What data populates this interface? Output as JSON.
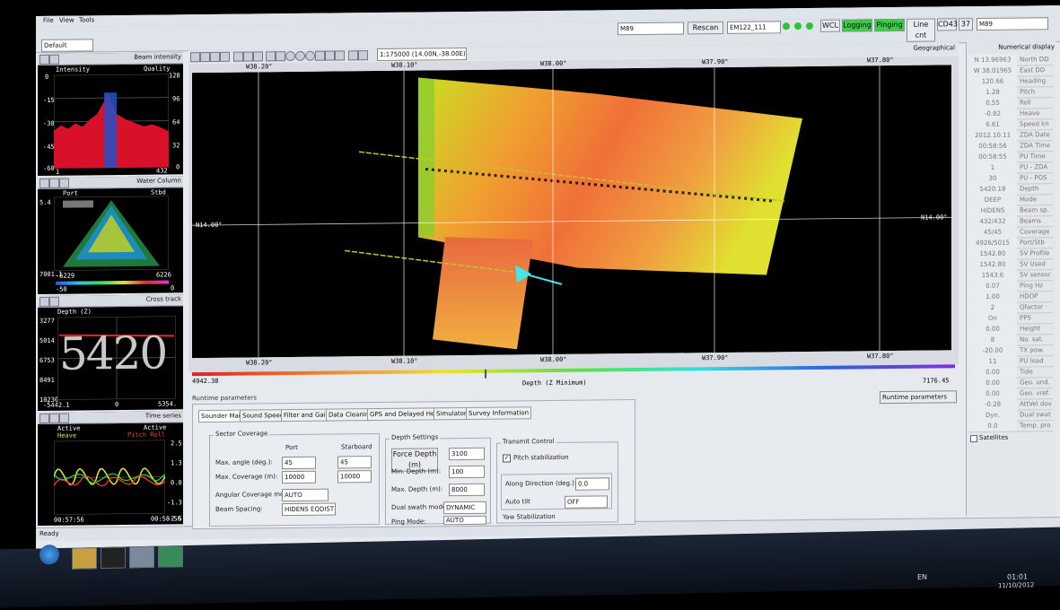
{
  "window": {
    "menu": [
      "File",
      "View",
      "Tools"
    ],
    "layout_select": "Default",
    "status": "Ready"
  },
  "toolbar": {
    "device_select": "M89",
    "rescan_label": "Rescan",
    "system_select": "EM122_111",
    "wcl_label": "WCL",
    "logging_label": "Logging",
    "pinging_label": "Pinging",
    "linecnt_label": "Line cnt",
    "mode_label": "CD43",
    "mode_num": "37",
    "right_select": "M89"
  },
  "left_panels": {
    "beam_intensity": {
      "dropdown": "Beam intensity",
      "label_left": "Intensity",
      "label_right": "Quality",
      "y_ticks_left": [
        "0",
        "-15",
        "-30",
        "-45",
        "-60"
      ],
      "y_ticks_right": [
        "128",
        "96",
        "64",
        "32",
        "0"
      ],
      "x_ticks": [
        "1",
        "432"
      ]
    },
    "water_column": {
      "dropdown": "Water Column",
      "label_port": "Port",
      "label_stbd": "Stbd",
      "depth_top": "5.4",
      "depth_bottom": "7001.1",
      "x_left": "-6229",
      "x_right": "6226",
      "scale_left": "-50",
      "scale_right": "0"
    },
    "cross_track": {
      "dropdown": "Cross track",
      "label": "Depth (Z)",
      "y_ticks": [
        "3277",
        "5014",
        "6753",
        "8491",
        "10230"
      ],
      "big_value": "5420",
      "x_left": "-5442.1",
      "x_mid": "0",
      "x_right": "5354."
    },
    "time_series": {
      "dropdown": "Time series",
      "active_left": "Active",
      "heave": "Heave",
      "active_right": "Active",
      "pitch_roll": "Pitch  Roll",
      "y_ticks": [
        "2.5",
        "1.3",
        "0.0",
        "-1.3",
        "-2.5"
      ],
      "time_left": "00:57:56",
      "time_right": "00:58:56"
    }
  },
  "geo": {
    "dropdown": "Geographical",
    "cursor_readout": "1:175000 (14.00N,-38.00E)",
    "top_lon_labels": [
      "W38.20°",
      "W38.10°",
      "W38.00°",
      "W37.90°",
      "W37.80°"
    ],
    "bottom_lon_labels": [
      "W38.20°",
      "W38.10°",
      "W38.00°",
      "W37.90°",
      "W37.80°"
    ],
    "lat_left": "N14.00°",
    "lat_right": "N14.00°",
    "colorbar_min": "4942.38",
    "colorbar_max": "7176.45",
    "colorbar_label": "Depth (Z Minimum)"
  },
  "runtime": {
    "title": "Runtime parameters",
    "dropdown": "Runtime parameters",
    "tabs": [
      "Sounder Main",
      "Sound Speed",
      "Filter and Gains",
      "Data Cleaning",
      "GPS and Delayed Heave",
      "Simulator",
      "Survey Information"
    ],
    "sector": {
      "title": "Sector Coverage",
      "port": "Port",
      "starboard": "Starboard",
      "max_angle_label": "Max. angle (deg.):",
      "max_angle_port": "45",
      "max_angle_stbd": "45",
      "max_cov_label": "Max. Coverage (m):",
      "max_cov_port": "10000",
      "max_cov_stbd": "10000",
      "ang_mode_label": "Angular Coverage mode:",
      "ang_mode": "AUTO",
      "beam_spacing_label": "Beam Spacing:",
      "beam_spacing": "HIDENS EQDIST"
    },
    "depth": {
      "title": "Depth Settings",
      "force_depth_label": "Force Depth (m)",
      "force_depth": "3100",
      "min_depth_label": "Min. Depth (m):",
      "min_depth": "100",
      "max_depth_label": "Max. Depth (m):",
      "max_depth": "8000",
      "dual_swath_label": "Dual swath mode:",
      "dual_swath": "DYNAMIC",
      "ping_mode_label": "Ping Mode:",
      "ping_mode": "AUTO"
    },
    "transmit": {
      "title": "Transmit Control",
      "pitch_stab_label": "Pitch stabilization",
      "along_dir_label": "Along Direction (deg.):",
      "along_dir": "0.0",
      "auto_tilt_label": "Auto tilt",
      "auto_tilt": "OFF",
      "yaw_label": "Yaw Stabilization"
    }
  },
  "numeric_display": {
    "dropdown": "Numerical display",
    "rows": [
      {
        "v": "N 13.96963",
        "n": "North DD"
      },
      {
        "v": "W 38.01965",
        "n": "East DD"
      },
      {
        "v": "120.66",
        "n": "Heading"
      },
      {
        "v": "1.28",
        "n": "Pitch"
      },
      {
        "v": "0.55",
        "n": "Roll"
      },
      {
        "v": "-0.82",
        "n": "Heave"
      },
      {
        "v": "6.61",
        "n": "Speed kn"
      },
      {
        "v": "2012.10.11",
        "n": "ZDA Date"
      },
      {
        "v": "00:58:56",
        "n": "ZDA Time"
      },
      {
        "v": "00:58:55",
        "n": "PU Time"
      },
      {
        "v": "1",
        "n": "PU - ZDA"
      },
      {
        "v": "30",
        "n": "PU - POS"
      },
      {
        "v": "5420.18",
        "n": "Depth"
      },
      {
        "v": "DEEP",
        "n": "Mode"
      },
      {
        "v": "HIDENS EQDIST",
        "n": "Beam sp."
      },
      {
        "v": "432/432",
        "n": "Beams"
      },
      {
        "v": "45/45",
        "n": "Coverage"
      },
      {
        "v": "4926/5015",
        "n": "Port/Stb"
      },
      {
        "v": "1542.80",
        "n": "SV Profile"
      },
      {
        "v": "1542.80",
        "n": "SV Used"
      },
      {
        "v": "1543.6",
        "n": "SV sensor"
      },
      {
        "v": "0.07",
        "n": "Ping Hz"
      },
      {
        "v": "1.00",
        "n": "HDOP"
      },
      {
        "v": "2",
        "n": "Qfactor"
      },
      {
        "v": "On",
        "n": "PPS"
      },
      {
        "v": "0.00",
        "n": "Height"
      },
      {
        "v": "8",
        "n": "No. sat."
      },
      {
        "v": "-20.00",
        "n": "TX pow."
      },
      {
        "v": "11",
        "n": "PU load"
      },
      {
        "v": "0.00",
        "n": "Tide"
      },
      {
        "v": "0.00",
        "n": "Geo. und."
      },
      {
        "v": "0.00",
        "n": "Geo. vref."
      },
      {
        "v": "-0.28",
        "n": "AttVel dov"
      },
      {
        "v": "Dyn.",
        "n": "Dual swat"
      },
      {
        "v": "0.0",
        "n": "Temp. pro"
      }
    ],
    "satellites_label": "Satellites"
  },
  "taskbar": {
    "lang": "EN",
    "time": "01:01",
    "date": "11/10/2012"
  }
}
